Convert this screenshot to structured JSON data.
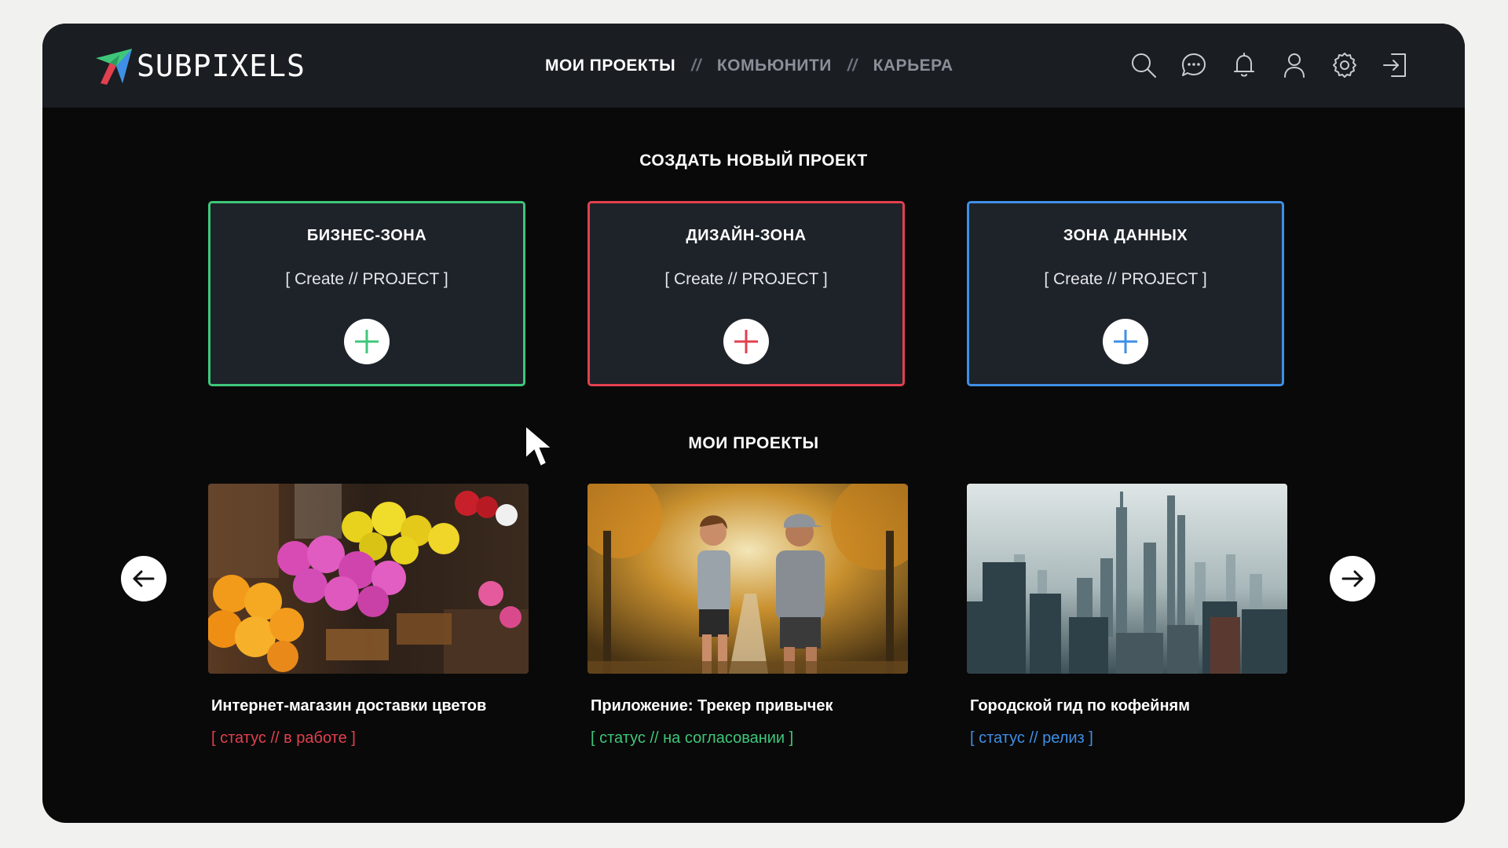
{
  "brand": {
    "name": "SUBPIXELS"
  },
  "nav": {
    "items": [
      {
        "label": "МОИ ПРОЕКТЫ"
      },
      {
        "label": "КОМЬЮНИТИ"
      },
      {
        "label": "КАРЬЕРА"
      }
    ],
    "separator": "//"
  },
  "header_icons": [
    "search-icon",
    "chat-icon",
    "bell-icon",
    "user-icon",
    "gear-icon",
    "logout-icon"
  ],
  "create_section": {
    "title": "СОЗДАТЬ НОВЫЙ ПРОЕКТ",
    "zones": [
      {
        "title": "БИЗНЕС-ЗОНА",
        "subtitle": "[ Create // PROJECT ]",
        "color": "#3ec77a"
      },
      {
        "title": "ДИЗАЙН-ЗОНА",
        "subtitle": "[ Create // PROJECT ]",
        "color": "#e2404f"
      },
      {
        "title": "ЗОНА ДАННЫХ",
        "subtitle": "[ Create // PROJECT ]",
        "color": "#3f8fe6"
      }
    ]
  },
  "projects_section": {
    "title": "МОИ ПРОЕКТЫ",
    "projects": [
      {
        "title": "Интернет-магазин доставки цветов",
        "status": "[ статус // в работе ]",
        "status_color": "#e2404f",
        "image": "flower-shop-photo"
      },
      {
        "title": "Приложение: Трекер привычек",
        "status": "[ статус // на согласовании ]",
        "status_color": "#3ec77a",
        "image": "running-couple-photo"
      },
      {
        "title": "Городской гид по кофейням",
        "status": "[ статус // релиз ]",
        "status_color": "#3f8fe6",
        "image": "city-skyline-photo"
      }
    ]
  },
  "colors": {
    "background": "#090909",
    "header": "#1a1d22",
    "card": "#1e2329"
  }
}
